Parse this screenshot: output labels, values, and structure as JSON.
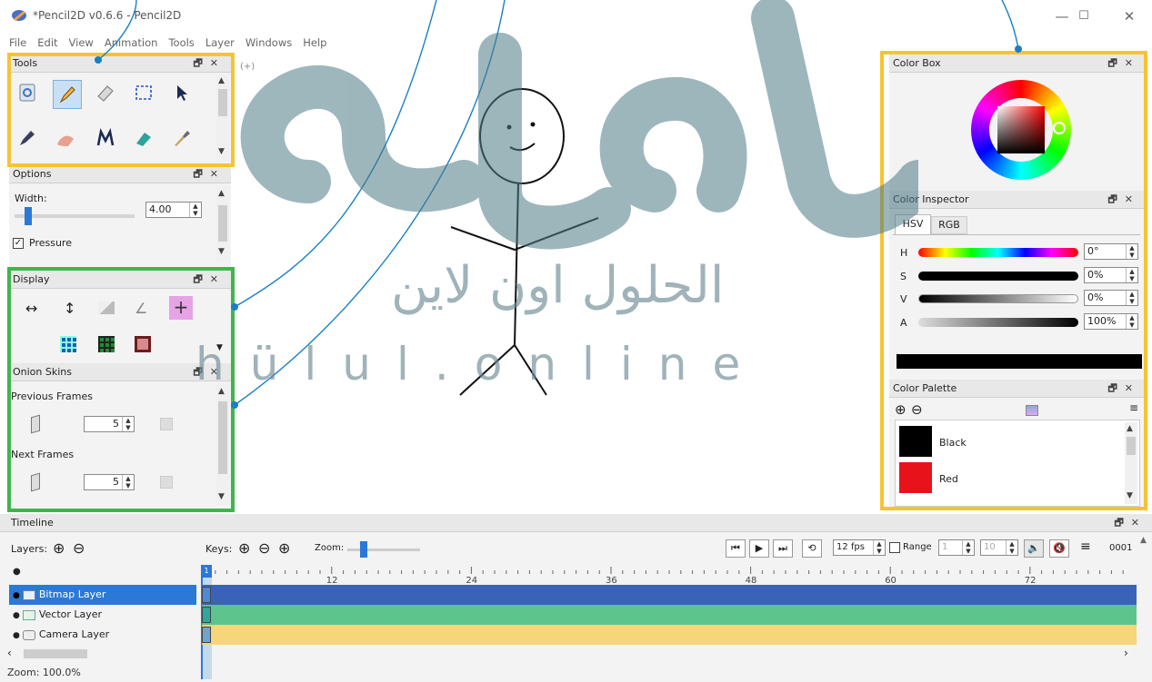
{
  "window": {
    "title": "*Pencil2D v0.6.6 - Pencil2D",
    "minimize": "—",
    "maximize": "☐",
    "close": "✕"
  },
  "menu": [
    "File",
    "Edit",
    "View",
    "Animation",
    "Tools",
    "Layer",
    "Windows",
    "Help"
  ],
  "tools_panel": {
    "title": "Tools",
    "tools": [
      "clear-icon",
      "pencil-icon",
      "eraser-icon",
      "select-icon",
      "move-icon",
      "pen-icon",
      "smudge-icon",
      "polyline-icon",
      "bucket-icon",
      "eyedropper-icon"
    ]
  },
  "options_panel": {
    "title": "Options",
    "width_label": "Width:",
    "width_value": "4.00",
    "width_level": 0.08,
    "pressure_label": "Pressure"
  },
  "display_panel": {
    "title": "Display"
  },
  "onion_panel": {
    "title": "Onion Skins",
    "previous_label": "Previous Frames",
    "previous_value": "5",
    "next_label": "Next Frames",
    "next_value": "5"
  },
  "canvas": {
    "indicator": "(+)"
  },
  "color_box": {
    "title": "Color Box"
  },
  "color_inspector": {
    "title": "Color Inspector",
    "tabs": [
      "HSV",
      "RGB"
    ],
    "active_tab": "HSV",
    "sliders": [
      {
        "label": "H",
        "value": "0°"
      },
      {
        "label": "S",
        "value": "0%"
      },
      {
        "label": "V",
        "value": "0%"
      },
      {
        "label": "A",
        "value": "100%"
      }
    ],
    "current_color": "#000000"
  },
  "color_palette": {
    "title": "Color Palette",
    "colors": [
      {
        "name": "Black",
        "hex": "#000000"
      },
      {
        "name": "Red",
        "hex": "#e8121b"
      }
    ]
  },
  "timeline": {
    "title": "Timeline",
    "layers_label": "Layers:",
    "keys_label": "Keys:",
    "zoom_label": "Zoom:",
    "fps": "12 fps",
    "range_label": "Range",
    "range_start": "1",
    "range_end": "10",
    "frame_counter": "0001",
    "ruler_labels": [
      "12",
      "24",
      "36",
      "48",
      "60",
      "72"
    ],
    "current_frame": "1",
    "layers": [
      {
        "name": "Bitmap Layer",
        "color": "#3a63b8",
        "selected": true
      },
      {
        "name": "Vector Layer",
        "color": "#4cbf82",
        "selected": false
      },
      {
        "name": "Camera Layer",
        "color": "#f5d36a",
        "selected": false
      }
    ]
  },
  "status": {
    "zoom": "Zoom: 100.0%"
  },
  "watermark": {
    "arabic": "الحلول اون لاين",
    "latin": "hülul.online"
  }
}
